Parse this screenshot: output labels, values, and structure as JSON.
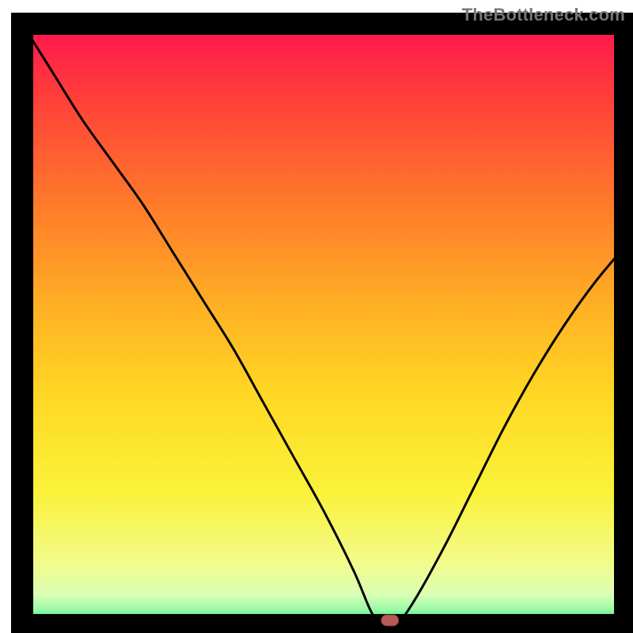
{
  "chart_data": {
    "type": "line",
    "title": "",
    "xlabel": "",
    "ylabel": "",
    "xlim": [
      0,
      100
    ],
    "ylim": [
      0,
      100
    ],
    "x": [
      0,
      5,
      10,
      15,
      20,
      25,
      30,
      35,
      40,
      45,
      50,
      55,
      58,
      60,
      62,
      65,
      70,
      75,
      80,
      85,
      90,
      95,
      100
    ],
    "series": [
      {
        "name": "bottleneck-curve",
        "values": [
          100,
          92,
          84,
          77,
          70,
          62,
          54,
          46,
          37,
          28,
          19,
          9,
          2,
          0,
          0,
          4,
          13,
          23,
          33,
          42,
          50,
          57,
          63
        ]
      }
    ],
    "marker": {
      "x": 61,
      "y": 0
    },
    "gradient_stops": [
      {
        "offset": 0.0,
        "color": "#ff1450"
      },
      {
        "offset": 0.12,
        "color": "#ff3e3a"
      },
      {
        "offset": 0.3,
        "color": "#ff7a2a"
      },
      {
        "offset": 0.48,
        "color": "#ffb324"
      },
      {
        "offset": 0.62,
        "color": "#ffd824"
      },
      {
        "offset": 0.78,
        "color": "#faf23a"
      },
      {
        "offset": 0.9,
        "color": "#f2fb8e"
      },
      {
        "offset": 0.95,
        "color": "#d8ffb4"
      },
      {
        "offset": 0.975,
        "color": "#98f9a8"
      },
      {
        "offset": 0.99,
        "color": "#3fe987"
      },
      {
        "offset": 1.0,
        "color": "#14db7a"
      }
    ],
    "frame_color": "#000000",
    "curve_color": "#000000",
    "marker_fill": "#b85a56",
    "marker_stroke": "#7e3a37"
  },
  "watermark": "TheBottleneck.com"
}
